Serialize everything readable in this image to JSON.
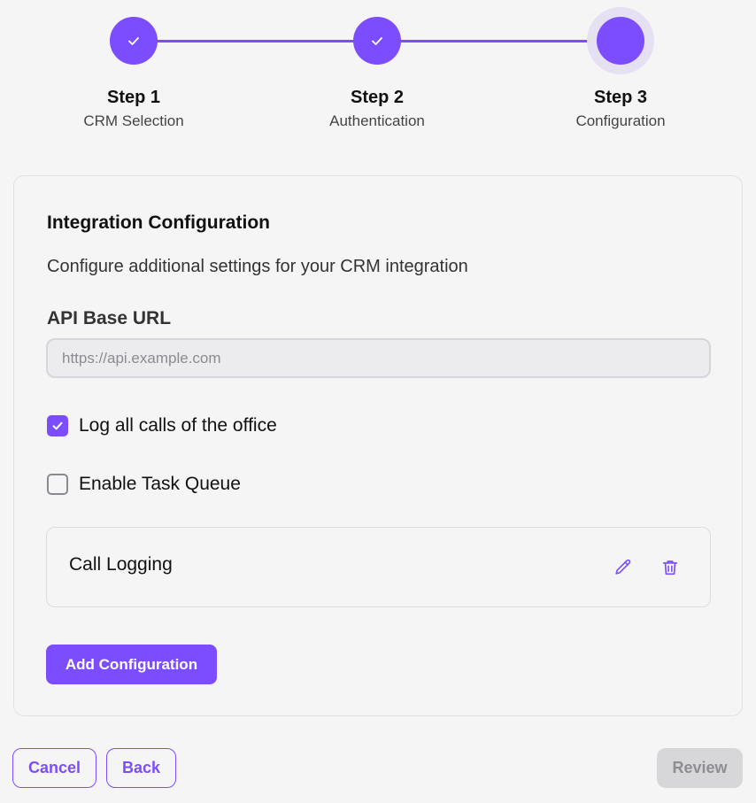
{
  "stepper": {
    "steps": [
      {
        "title": "Step 1",
        "subtitle": "CRM Selection",
        "status": "completed",
        "icon": "check-icon"
      },
      {
        "title": "Step 2",
        "subtitle": "Authentication",
        "status": "completed",
        "icon": "check-icon"
      },
      {
        "title": "Step 3",
        "subtitle": "Configuration",
        "status": "active"
      }
    ]
  },
  "card": {
    "title": "Integration Configuration",
    "description": "Configure additional settings for your CRM integration",
    "api_url": {
      "label": "API Base URL",
      "placeholder": "https://api.example.com",
      "value": ""
    },
    "checkboxes": [
      {
        "label": "Log all calls of the office",
        "checked": true
      },
      {
        "label": "Enable Task Queue",
        "checked": false
      }
    ],
    "configurations": [
      {
        "name": "Call Logging",
        "actions": [
          "pencil-icon",
          "trash-icon"
        ]
      }
    ],
    "add_button": "Add Configuration"
  },
  "footer": {
    "cancel": "Cancel",
    "back": "Back",
    "review": "Review"
  },
  "colors": {
    "accent": "#7c4dff",
    "active_ring": "#e6e0f3",
    "disabled_bg": "#d7d7da",
    "disabled_text": "#8d8d93",
    "background": "#f5f5f6"
  }
}
